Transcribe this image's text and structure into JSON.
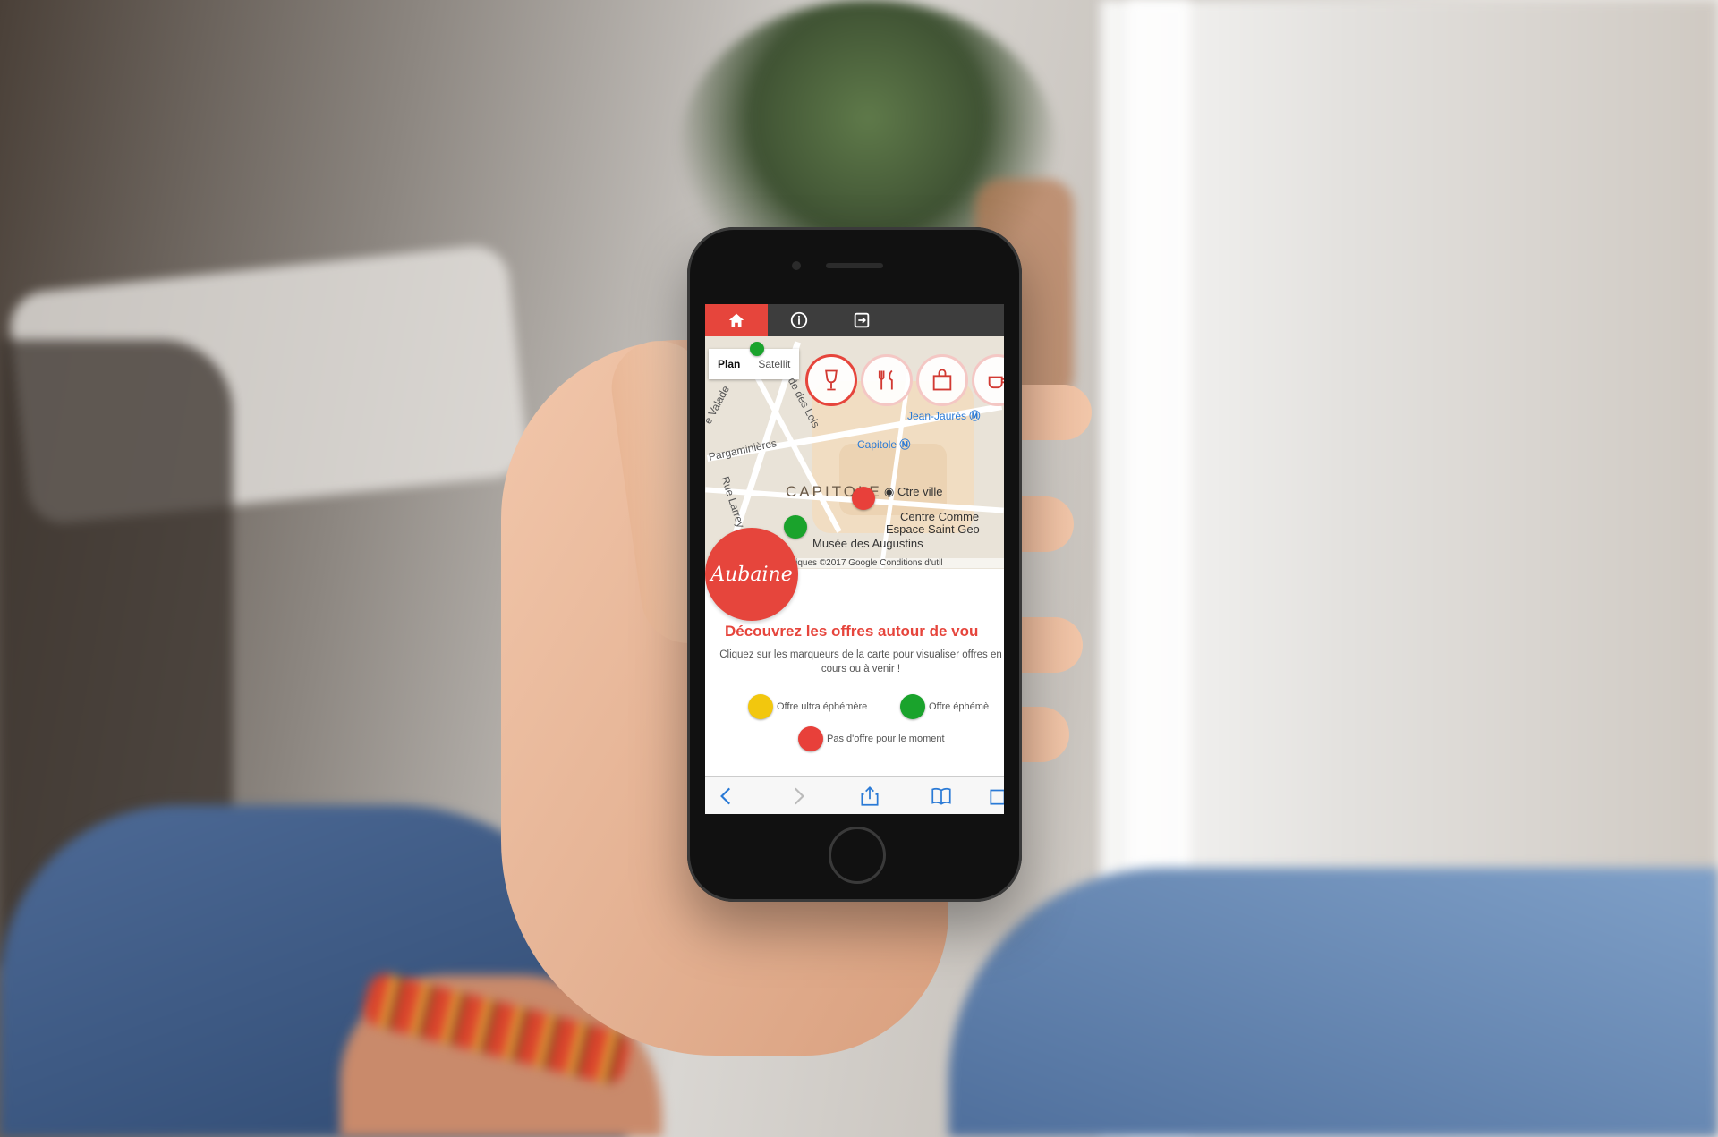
{
  "nav": {
    "items": [
      {
        "icon": "home-icon",
        "active": true
      },
      {
        "icon": "info-icon",
        "active": false
      },
      {
        "icon": "sign-in-icon",
        "active": false
      }
    ]
  },
  "map": {
    "toggle": {
      "plan": "Plan",
      "satellite": "Satellit"
    },
    "labels": {
      "jean_jaures": "Jean-Jaurès",
      "capitole_station": "Capitole",
      "capitole": "CAPITOLE",
      "ctre_ville": "Ctre ville",
      "centre_comm": "Centre Comme",
      "espace": "Espace Saint Geo",
      "musee": "Musée des Augustins",
      "parga": "Parga­minières",
      "larrey": "Rue Larrey",
      "valade": "e Valade",
      "lois": "de des Lois"
    },
    "credits": "phiques ©2017 Google    Conditions d'util",
    "categories": [
      "wine-glass-icon",
      "cutlery-icon",
      "shopping-bag-icon",
      "coffee-cup-icon"
    ]
  },
  "logo": {
    "text": "Aubaine"
  },
  "content": {
    "headline": "Découvrez les offres autour de vou",
    "intro": "Cliquez sur les marqueurs de la carte pour visualiser offres en cours ou à venir !",
    "legend": [
      {
        "label": "Offre ultra éphémère",
        "color": "#f2c70e"
      },
      {
        "label": "Offre éphémè",
        "color": "#1aa32c"
      },
      {
        "label": "Pas d'offre pour le moment",
        "color": "#e8403a"
      }
    ]
  },
  "colors": {
    "accent": "#e6453c",
    "navbar": "#3d3d3d",
    "link": "#2a7ad6"
  }
}
